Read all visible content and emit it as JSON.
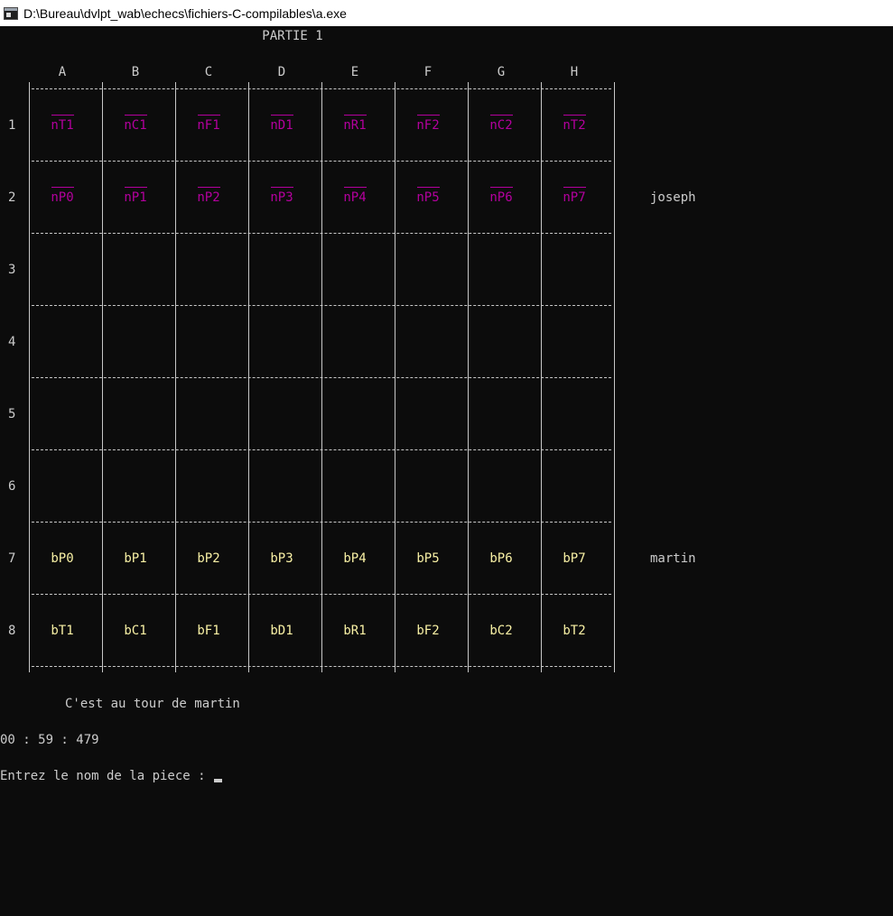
{
  "window": {
    "title": "D:\\Bureau\\dvlpt_wab\\echecs\\fichiers-C-compilables\\a.exe",
    "icon": "console-window-icon"
  },
  "game": {
    "heading": "PARTIE 1",
    "columns": [
      "A",
      "B",
      "C",
      "D",
      "E",
      "F",
      "G",
      "H"
    ],
    "rows": [
      "1",
      "2",
      "3",
      "4",
      "5",
      "6",
      "7",
      "8"
    ],
    "board": [
      [
        "nT1",
        "nC1",
        "nF1",
        "nD1",
        "nR1",
        "nF2",
        "nC2",
        "nT2"
      ],
      [
        "nP0",
        "nP1",
        "nP2",
        "nP3",
        "nP4",
        "nP5",
        "nP6",
        "nP7"
      ],
      [
        "",
        "",
        "",
        "",
        "",
        "",
        "",
        ""
      ],
      [
        "",
        "",
        "",
        "",
        "",
        "",
        "",
        ""
      ],
      [
        "",
        "",
        "",
        "",
        "",
        "",
        "",
        ""
      ],
      [
        "",
        "",
        "",
        "",
        "",
        "",
        "",
        ""
      ],
      [
        "bP0",
        "bP1",
        "bP2",
        "bP3",
        "bP4",
        "bP5",
        "bP6",
        "bP7"
      ],
      [
        "bT1",
        "bC1",
        "bF1",
        "bD1",
        "bR1",
        "bF2",
        "bC2",
        "bT2"
      ]
    ],
    "players": [
      {
        "name": "joseph",
        "row": 2
      },
      {
        "name": "martin",
        "row": 7
      }
    ],
    "turn_message": "C'est au tour de martin",
    "timer": "00 : 59 : 479",
    "prompt": "Entrez le nom de la piece : "
  },
  "colors": {
    "background": "#0c0c0c",
    "text": "#cccccc",
    "black_pieces": "#b4009e",
    "white_pieces": "#f9f1a5"
  }
}
